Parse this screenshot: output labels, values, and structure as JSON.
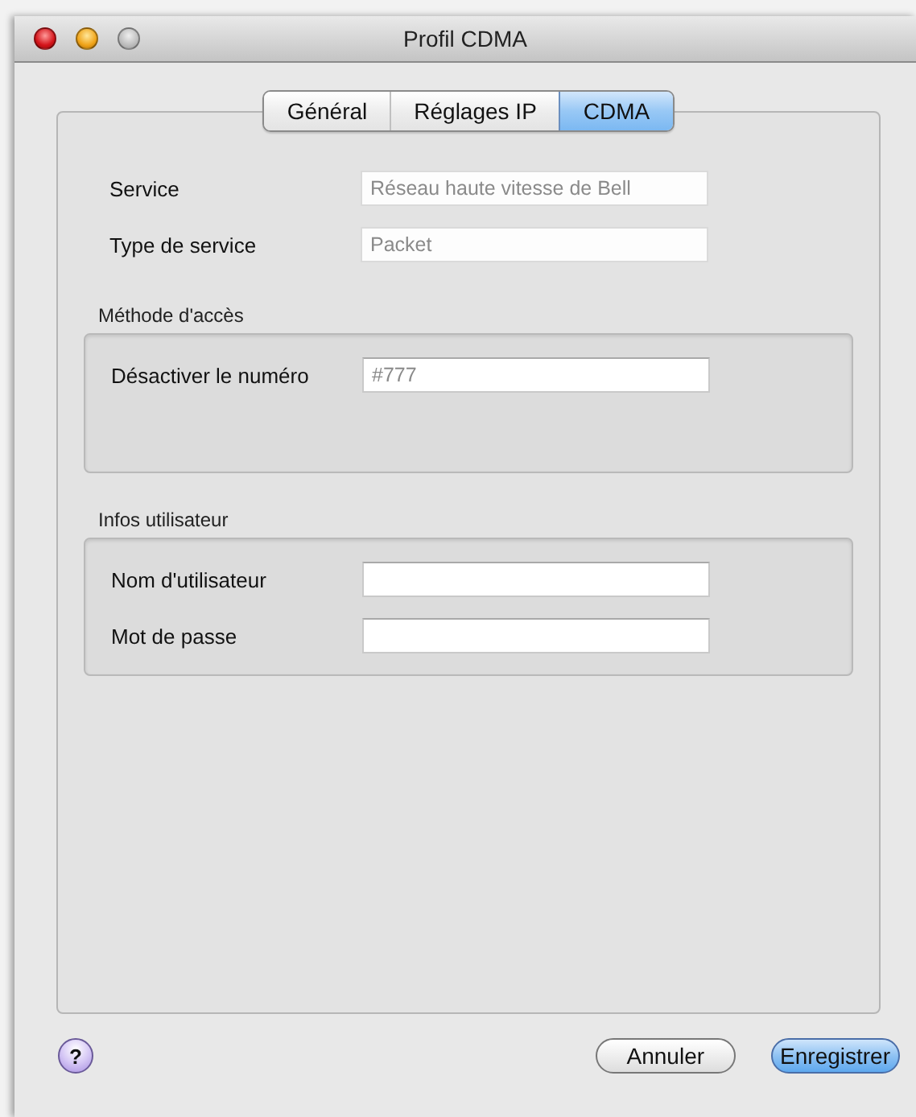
{
  "window": {
    "title": "Profil CDMA"
  },
  "tabs": [
    {
      "label": "Général",
      "selected": false
    },
    {
      "label": "Réglages IP",
      "selected": false
    },
    {
      "label": "CDMA",
      "selected": true
    }
  ],
  "fields": [
    {
      "label": "Service",
      "value": "Réseau haute vitesse de Bell",
      "disabled": true
    },
    {
      "label": "Type de service",
      "value": "Packet",
      "disabled": true
    }
  ],
  "groups": [
    {
      "title": "Méthode d'accès",
      "fields": [
        {
          "label": "Désactiver le numéro",
          "placeholder": "#777",
          "disabled": false
        }
      ]
    },
    {
      "title": "Infos utilisateur",
      "fields": [
        {
          "label": "Nom d'utilisateur",
          "disabled": false
        },
        {
          "label": "Mot de passe",
          "disabled": false
        }
      ]
    }
  ],
  "help": "?",
  "buttons": [
    {
      "label": "Annuler",
      "default": false
    },
    {
      "label": "Enregistrer",
      "default": true
    }
  ]
}
